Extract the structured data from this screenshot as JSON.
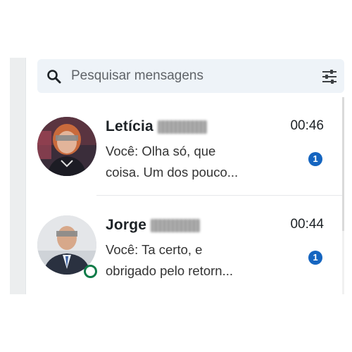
{
  "search": {
    "placeholder": "Pesquisar mensagens",
    "icon": "search-icon",
    "filter_icon": "filter-icon"
  },
  "conversations": [
    {
      "name": "Letícia",
      "time": "00:46",
      "preview_line1": "Você: Olha só, que",
      "preview_line2": "coisa. Um dos pouco...",
      "unread": "1",
      "online": false
    },
    {
      "name": "Jorge",
      "time": "00:44",
      "preview_line1": "Você: Ta certo, e",
      "preview_line2": "obrigado pelo retorn...",
      "unread": "1",
      "online": true
    }
  ],
  "colors": {
    "search_bg": "#eef3f8",
    "badge": "#1565c0",
    "online": "#0f7b48",
    "text": "#1d2226"
  }
}
